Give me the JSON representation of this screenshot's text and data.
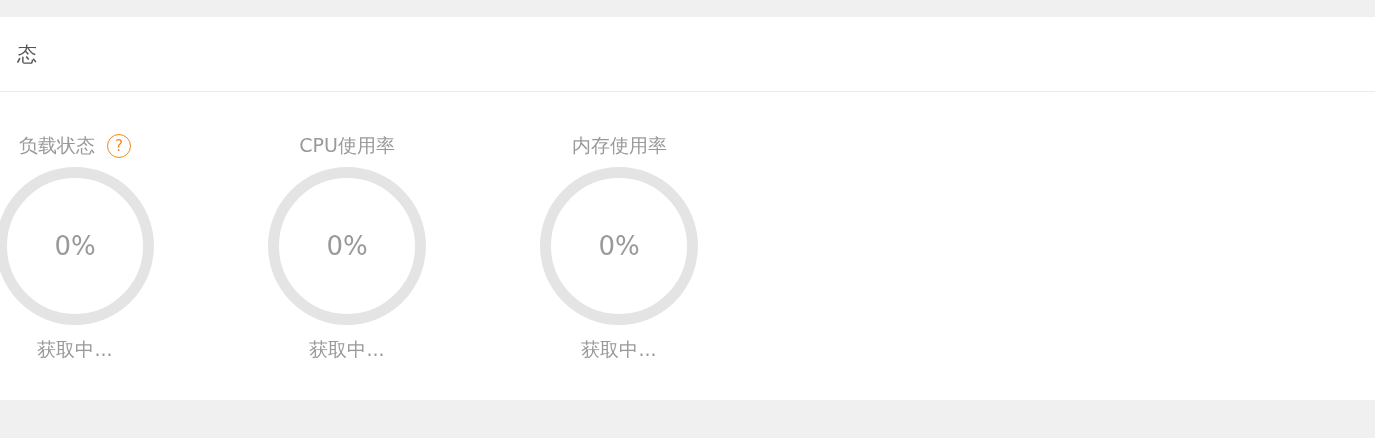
{
  "panel": {
    "title": "态"
  },
  "gauges": [
    {
      "label": "负载状态",
      "help_icon": "?",
      "value": "0%",
      "status": "获取中..."
    },
    {
      "label": "CPU使用率",
      "value": "0%",
      "status": "获取中..."
    },
    {
      "label": "内存使用率",
      "value": "0%",
      "status": "获取中..."
    }
  ]
}
